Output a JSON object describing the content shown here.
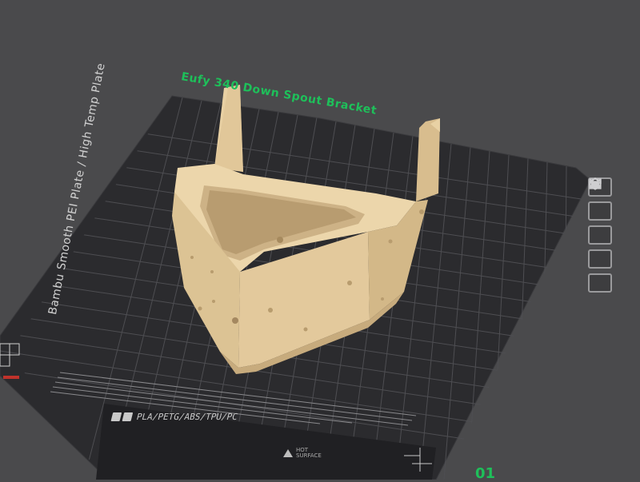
{
  "object": {
    "name_label": "Eufy 340 Down Spout Bracket"
  },
  "plate": {
    "type_label": "Bambu Smooth PEI Plate / High Temp Plate",
    "material_text": "PLA/PETG/ABS/TPU/PC",
    "warning_text": "HOT SURFACE",
    "number_label": "01"
  },
  "toolbar": {
    "icons": [
      "close-icon",
      "auto-orient-icon",
      "arrange-icon",
      "lock-icon",
      "settings-icon"
    ]
  },
  "colors": {
    "background": "#4a4a4c",
    "bed": "#2b2b2e",
    "grid": "#4e4e52",
    "model": "#e3c99c",
    "accent_green": "#1ec05a"
  }
}
